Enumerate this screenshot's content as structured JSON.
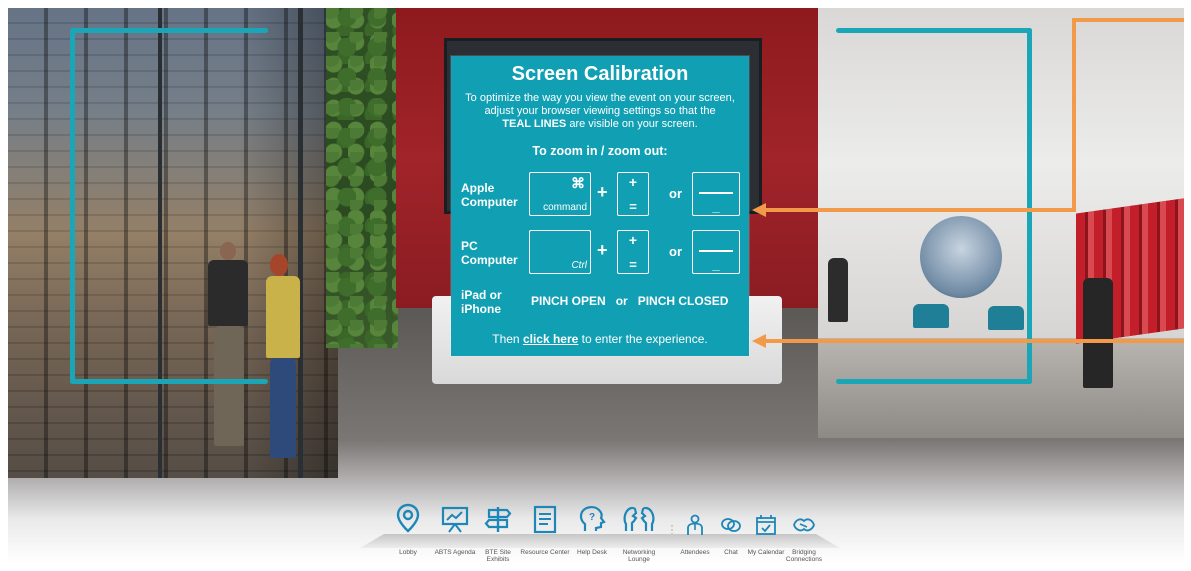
{
  "panel": {
    "title": "Screen Calibration",
    "intro_line1": "To optimize the way you view the event on your screen,",
    "intro_line2": "adjust your browser viewing settings so that the",
    "intro_bold": "TEAL LINES",
    "intro_end": " are visible on your screen.",
    "zoom_heading": "To zoom in / zoom out:",
    "rows": [
      {
        "label_line1": "Apple",
        "label_line2": "Computer",
        "modifier_symbol": "⌘",
        "modifier_sub": "command"
      },
      {
        "label_line1": "PC",
        "label_line2": "Computer",
        "modifier_symbol": "",
        "modifier_sub": "Ctrl"
      },
      {
        "label_line1": "iPad or",
        "label_line2": "iPhone"
      }
    ],
    "plus": "+",
    "or": "or",
    "plus_key_top": "+",
    "plus_key_bottom": "=",
    "minus_key_bottom": "_",
    "pinch_open": "PINCH OPEN",
    "pinch_or": "or",
    "pinch_closed": "PINCH CLOSED",
    "then_prefix": "Then ",
    "click_here": "click here",
    "then_suffix": " to enter the experience."
  },
  "toolbar": {
    "items": [
      {
        "label": "Lobby",
        "icon": "location-pin-icon"
      },
      {
        "label": "ABTS Agenda",
        "icon": "presentation-board-icon"
      },
      {
        "label": "BTE Site Exhibits",
        "icon": "signpost-icon"
      },
      {
        "label": "Resource Center",
        "icon": "document-icon"
      },
      {
        "label": "Help Desk",
        "icon": "head-question-icon"
      },
      {
        "label": "Networking Lounge",
        "icon": "networking-faces-icon"
      },
      {
        "label": "Attendees",
        "icon": "attendee-icon"
      },
      {
        "label": "Chat",
        "icon": "chat-bubbles-icon"
      },
      {
        "label": "My Calendar",
        "icon": "calendar-icon"
      },
      {
        "label": "Bridging Connections",
        "icon": "handshake-icon"
      }
    ]
  },
  "colors": {
    "teal": "#1aa6b7",
    "panel": "#119fb3",
    "arrow": "#f39a4a",
    "toolbar_icon": "#1d87b8"
  }
}
